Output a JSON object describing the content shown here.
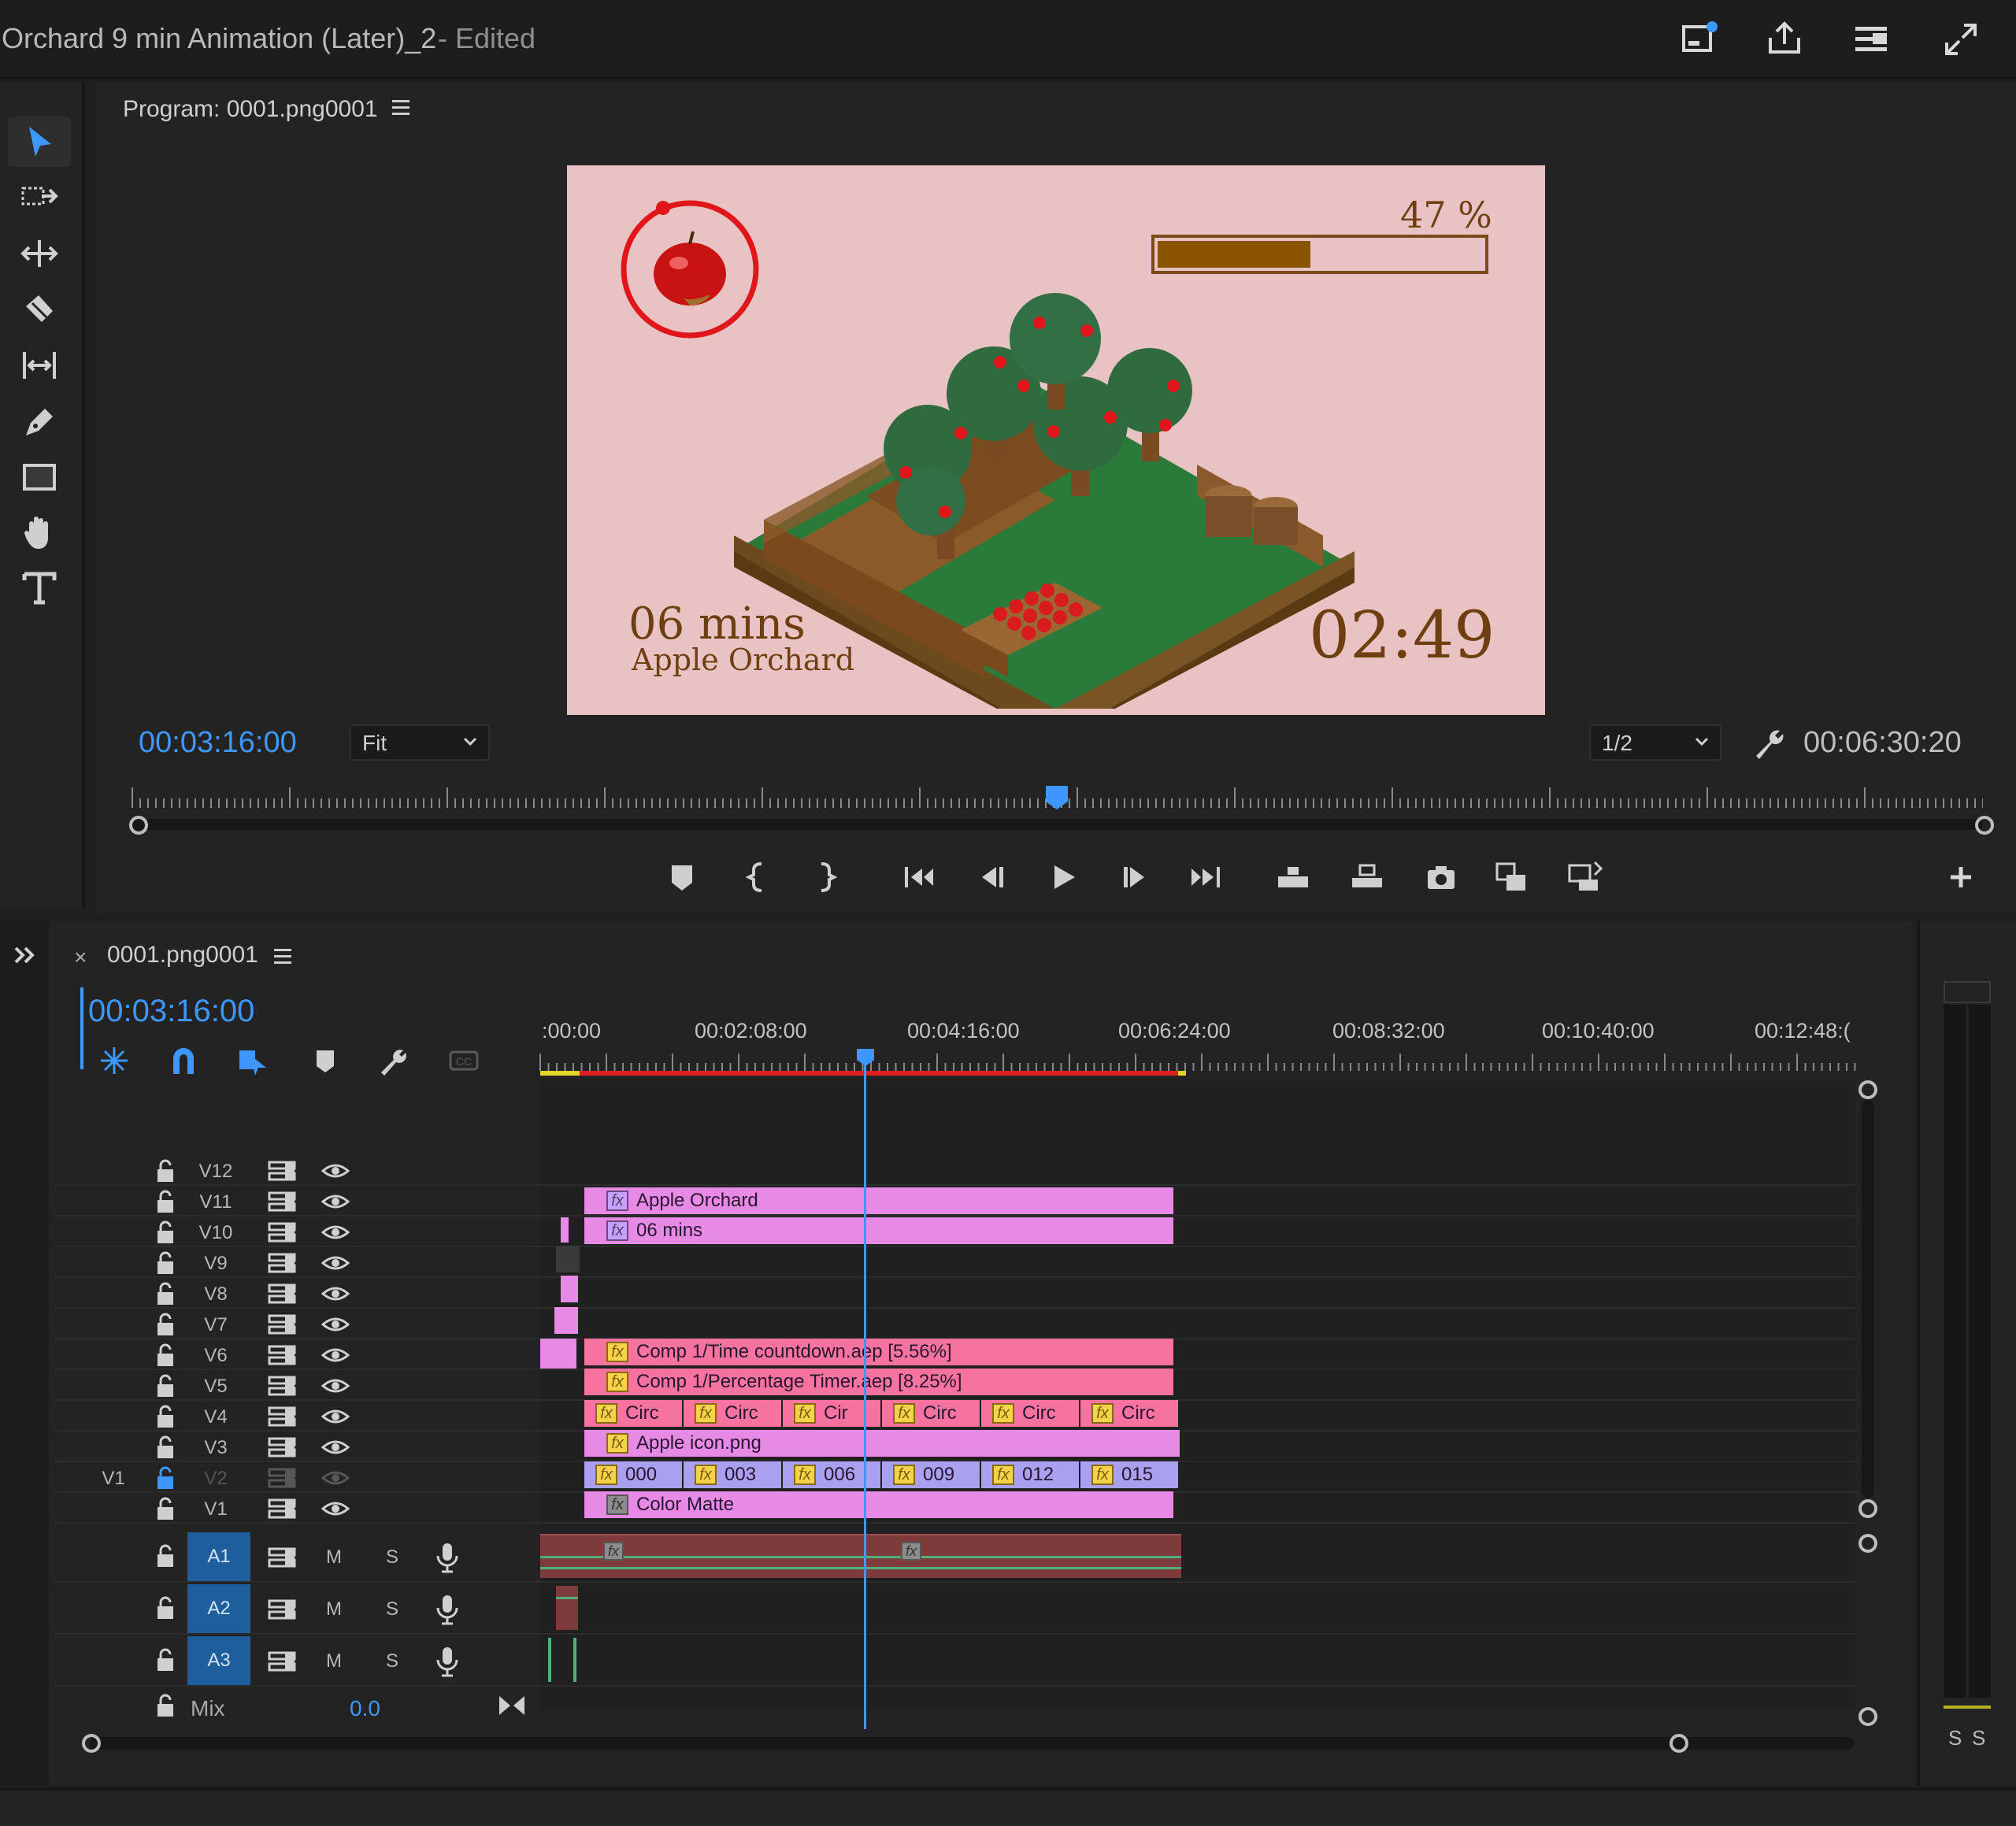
{
  "window": {
    "title": "Orchard 9 min Animation (Later)_2",
    "edited": "- Edited"
  },
  "top_icons": [
    "notification-icon",
    "share-icon",
    "workspace-menu-icon",
    "fullscreen-icon"
  ],
  "tools": [
    "selection-tool-icon",
    "track-select-tool-icon",
    "ripple-edit-tool-icon",
    "razor-tool-icon",
    "slip-tool-icon",
    "pen-tool-icon",
    "rectangle-tool-icon",
    "hand-tool-icon",
    "type-tool-icon"
  ],
  "program_monitor": {
    "title": "Program: 0001.png0001",
    "timecode": "00:03:16:00",
    "zoom": "Fit",
    "resolution": "1/2",
    "duration": "00:06:30:20",
    "frame": {
      "percent_label": "47 %",
      "progress": 0.47,
      "minutes": "06 mins",
      "subtitle": "Apple Orchard",
      "countdown": "02:49"
    }
  },
  "transport_buttons": [
    "add-marker-icon",
    "mark-in-icon",
    "mark-out-icon",
    "go-to-in-icon",
    "step-back-icon",
    "play-icon",
    "step-forward-icon",
    "go-to-out-icon",
    "lift-icon",
    "extract-icon",
    "export-frame-icon",
    "insert-icon",
    "overwrite-icon"
  ],
  "timeline": {
    "sequence_name": "0001.png0001",
    "timecode": "00:03:16:00",
    "ruler_labels": [
      ":00:00",
      "00:02:08:00",
      "00:04:16:00",
      "00:06:24:00",
      "00:08:32:00",
      "00:10:40:00",
      "00:12:48:("
    ],
    "video_tracks": [
      "V12",
      "V11",
      "V10",
      "V9",
      "V8",
      "V7",
      "V6",
      "V5",
      "V4",
      "V3",
      "V2",
      "V1"
    ],
    "source_patch": "V1",
    "audio_tracks": [
      "A1",
      "A2",
      "A3"
    ],
    "mute_label": "M",
    "solo_label": "S",
    "mix_label": "Mix",
    "mix_value": "0.0",
    "clips": {
      "v11": "Apple Orchard",
      "v10": "06 mins",
      "v6": "Comp 1/Time countdown.aep [5.56%]",
      "v5": "Comp 1/Percentage Timer.aep [8.25%]",
      "v4": [
        "Circ",
        "Circ",
        "Cir",
        "Circ",
        "Circ",
        "Circ"
      ],
      "v3": "Apple icon.png",
      "v2": [
        "000",
        "003",
        "006",
        "009",
        "012",
        "015"
      ],
      "v1": "Color Matte"
    }
  },
  "meters": {
    "solo_labels": [
      "S",
      "S"
    ]
  },
  "colors": {
    "accent": "#3d97ff",
    "clip_pink": "#e68ae6",
    "clip_rose": "#f7739f",
    "clip_lavender": "#a9a0f0",
    "audio_clip": "#7d3b3b",
    "frame_bg": "#e9c3c4"
  }
}
